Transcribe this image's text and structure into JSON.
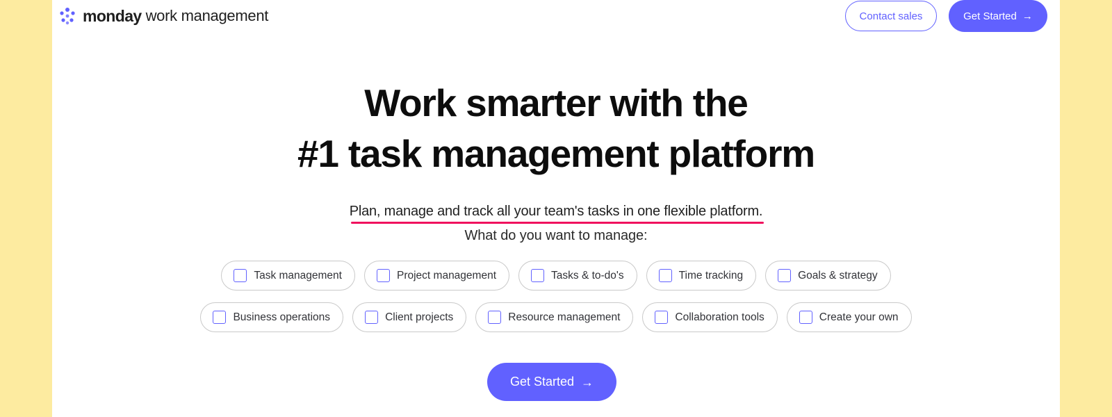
{
  "header": {
    "logo_brand": "monday",
    "logo_product": "work management",
    "contact_sales_label": "Contact sales",
    "get_started_label": "Get Started",
    "arrow_icon": "→"
  },
  "hero": {
    "title_line1": "Work smarter with the",
    "title_line2": "#1 task management platform",
    "subtitle": "Plan, manage and track all your team's tasks in one flexible platform.",
    "question": "What do you want to manage:"
  },
  "options": {
    "row1": [
      {
        "label": "Task management",
        "checked": false
      },
      {
        "label": "Project management",
        "checked": false
      },
      {
        "label": "Tasks & to-do's",
        "checked": false
      },
      {
        "label": "Time tracking",
        "checked": false
      },
      {
        "label": "Goals & strategy",
        "checked": false
      }
    ],
    "row2": [
      {
        "label": "Business operations",
        "checked": false
      },
      {
        "label": "Client projects",
        "checked": false
      },
      {
        "label": "Resource management",
        "checked": false
      },
      {
        "label": "Collaboration tools",
        "checked": false
      },
      {
        "label": "Create your own",
        "checked": false
      }
    ]
  },
  "cta": {
    "get_started_label": "Get Started",
    "arrow_icon": "→"
  },
  "colors": {
    "accent": "#6161ff",
    "underline": "#f0115e",
    "side_background": "#fdeba0",
    "logo_dots": "#6161ff"
  }
}
